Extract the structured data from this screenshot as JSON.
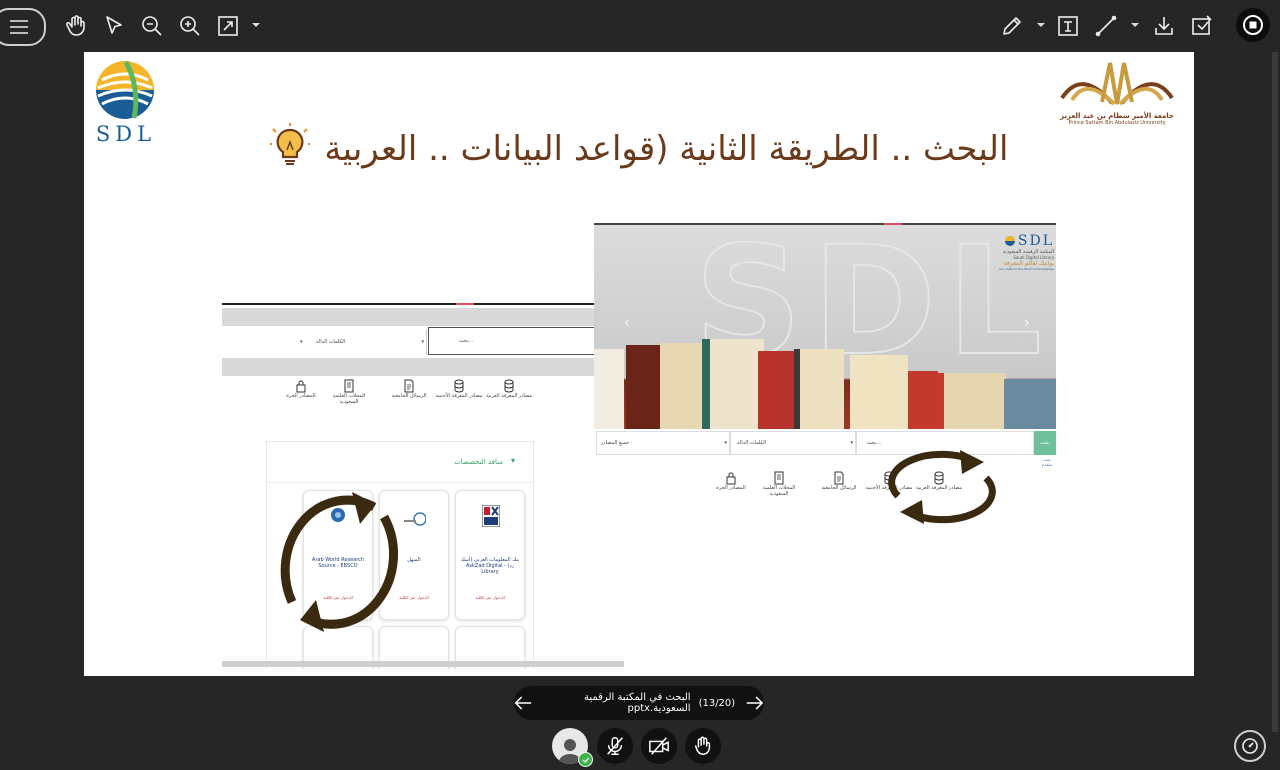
{
  "slide": {
    "title": "البحث .. الطريقة الثانية (قواعد البيانات .. العربية",
    "sdl_logo_text": "SDL",
    "university_logo": {
      "name_ar": "جامعة الأمير سطام بن عبد العزيز",
      "name_en": "Prince Sattam Bin Abdulaziz University"
    },
    "left_screenshot": {
      "search_placeholder": "بحث...",
      "select_1": "الكلمات الدالة",
      "categories": [
        "مصادر المعرفة العربية",
        "مصادر المعرفة الأجنبية",
        "الرسائل الجامعية",
        "المجلات العلمية السعودية",
        "المصادر الحرة"
      ],
      "section_header": "منافذ التخصصات",
      "cards": [
        {
          "title": "بنك المعلومات العربي (أسك زد) - AskZad Digital Library",
          "link": "الدخول عبر الكلية"
        },
        {
          "title": "المنهل",
          "link": "الدخول عبر الكلية"
        },
        {
          "title": "Arab World Research Source - EBSCO",
          "link": "الدخول عبر الكلية"
        }
      ]
    },
    "right_screenshot": {
      "sdl_name": "SDL",
      "library_name_ar": "المكتبة الرقمية السعودية",
      "library_name_en": "Saudi Digital Library",
      "tagline_ar": "بوابتك لعالم المعرفة",
      "tagline_en": "Your Gate to the World of Knowledge",
      "search_button": "بحث",
      "search_placeholder": "بحث...",
      "select_1": "الكلمات الدالة",
      "select_2": "جميع المصادر",
      "advanced_link": "بحث متقدم",
      "categories": [
        "مصادر المعرفة العربية",
        "مصادر المعرفة الأجنبية",
        "الرسائل الجامعية",
        "المجلات العلمية السعودية",
        "المصادر الحرة"
      ],
      "carousel_prev": "‹",
      "carousel_next": "›"
    }
  },
  "navigation": {
    "file_name": "البحث في المكتبة الرقمية السعودية.pptx",
    "page_indicator": "(13/20)"
  },
  "colors": {
    "app_bg": "#262626",
    "title_color": "#6b3a1a",
    "arrow_color": "#3a2a10",
    "status_green": "#3bb54a"
  }
}
